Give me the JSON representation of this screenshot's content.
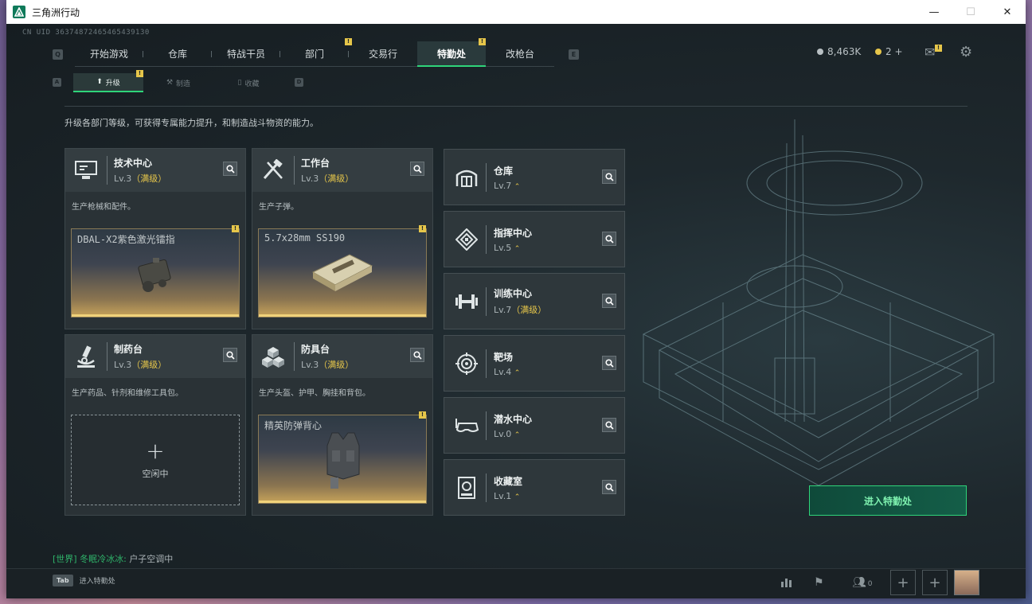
{
  "window": {
    "title": "三角洲行动",
    "minimize": "—",
    "maximize": "☐",
    "close": "✕"
  },
  "uid": "CN UID 363748724654654391​30",
  "top_nav": {
    "left_key": "Q",
    "right_key": "E",
    "tabs": [
      {
        "label": "开始游戏",
        "badge": ""
      },
      {
        "label": "仓库",
        "badge": ""
      },
      {
        "label": "特战干员",
        "badge": ""
      },
      {
        "label": "部门",
        "badge": "!"
      },
      {
        "label": "交易行",
        "badge": ""
      },
      {
        "label": "特勤处",
        "badge": "!"
      },
      {
        "label": "改枪台",
        "badge": ""
      }
    ]
  },
  "currency": {
    "silver": "8,463K",
    "gold": "2 +"
  },
  "mail_badge": "!",
  "sub_nav": {
    "left_key": "A",
    "right_key": "D",
    "tabs": [
      {
        "label": "升级",
        "badge": "!"
      },
      {
        "label": "制造",
        "badge": ""
      },
      {
        "label": "收藏",
        "badge": ""
      }
    ]
  },
  "description": "升级各部门等级，可获得专属能力提升，和制造战斗物资的能力。",
  "cards": [
    {
      "name": "技术中心",
      "lvl": "Lv.3",
      "max": "（满级）",
      "desc": "生产枪械和配件。",
      "item": "DBAL-X2紫色激光镭指",
      "badge": "!"
    },
    {
      "name": "工作台",
      "lvl": "Lv.3",
      "max": "（满级）",
      "desc": "生产子弹。",
      "item": "5.7x28mm SS190",
      "badge": "!"
    },
    {
      "name": "制药台",
      "lvl": "Lv.3",
      "max": "（满级）",
      "desc": "生产药品、针剂和维修工具包。",
      "idle": "空闲中",
      "plus": "+"
    },
    {
      "name": "防具台",
      "lvl": "Lv.3",
      "max": "（满级）",
      "desc": "生产头盔、护甲、胸挂和背包。",
      "item": "精英防弹背心",
      "badge": "!"
    }
  ],
  "departments": [
    {
      "name": "仓库",
      "lvl": "Lv.7",
      "max": "",
      "up": "⌃"
    },
    {
      "name": "指挥中心",
      "lvl": "Lv.5",
      "max": "",
      "up": "⌃"
    },
    {
      "name": "训练中心",
      "lvl": "Lv.7",
      "max": "（满级）",
      "up": ""
    },
    {
      "name": "靶场",
      "lvl": "Lv.4",
      "max": "",
      "up": "⌃"
    },
    {
      "name": "潜水中心",
      "lvl": "Lv.0",
      "max": "",
      "up": "⌃"
    },
    {
      "name": "收藏室",
      "lvl": "Lv.1",
      "max": "",
      "up": "⌃"
    }
  ],
  "enter_button": "进入特勤处",
  "chat": {
    "channel": "[世界]",
    "user": "冬眠冷冰冰:",
    "message": "户子空调中"
  },
  "bottom": {
    "tab_key": "Tab",
    "tab_label": "进入特勤处",
    "friends_count": "0",
    "plus": "+"
  },
  "colors": {
    "accent_green": "#2fd47a",
    "gold": "#e6c64a"
  }
}
